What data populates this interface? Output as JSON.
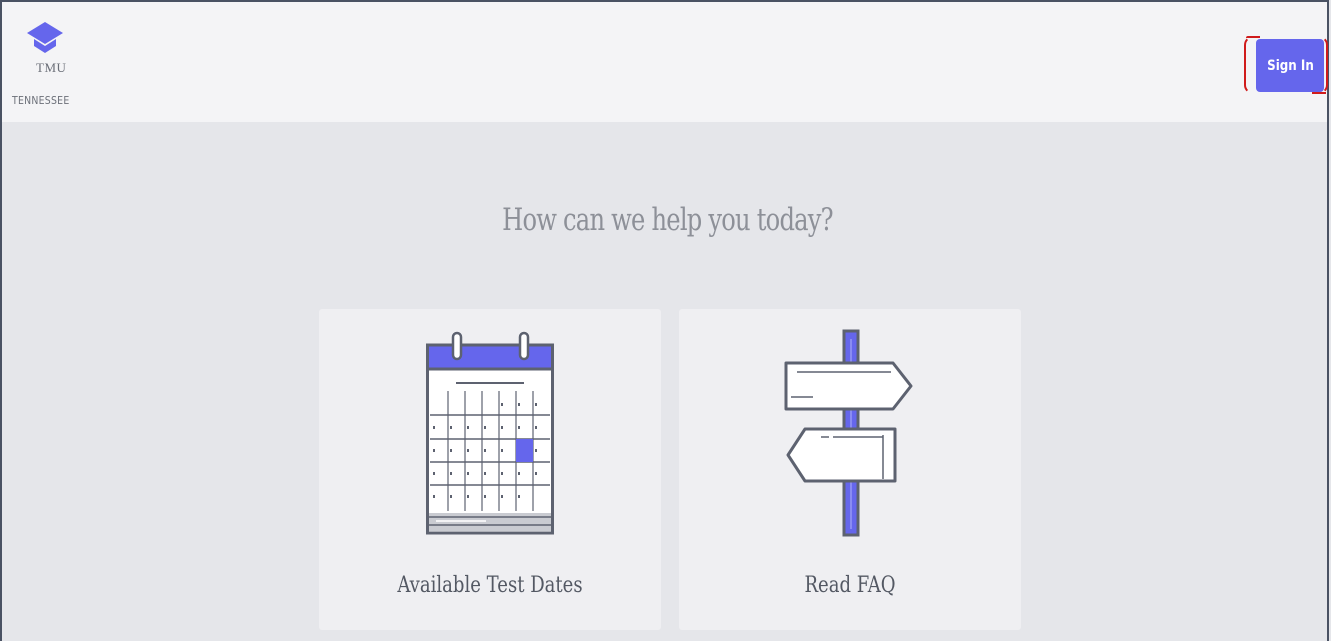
{
  "header": {
    "logo": {
      "name": "TMU",
      "state": "TENNESSEE",
      "mark_color": "#6566ec"
    },
    "sign_in_label": "Sign In"
  },
  "main": {
    "headline": "How can we help you today?",
    "cards": [
      {
        "label": "Available Test Dates",
        "icon": "calendar-icon"
      },
      {
        "label": "Read FAQ",
        "icon": "signpost-icon"
      }
    ]
  },
  "colors": {
    "accent": "#6566ec",
    "highlight": "#d01b1b"
  }
}
